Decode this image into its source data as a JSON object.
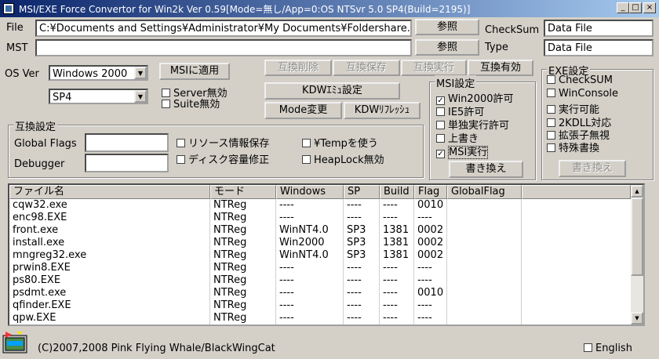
{
  "window": {
    "title": "MSI/EXE Force Convertor for Win2k Ver 0.59[Mode=無し/App=0:OS NTSvr 5.0 SP4(Build=2195)]",
    "controls": {
      "minimize": "_",
      "maximize": "□",
      "close": "×"
    }
  },
  "file_row": {
    "label": "File",
    "value": "C:¥Documents and Settings¥Administrator¥My Documents¥Foldershare.msi",
    "browse": "参照"
  },
  "mst_row": {
    "label": "MST",
    "value": "",
    "browse": "参照"
  },
  "checksum": {
    "label": "CheckSum",
    "value": "Data File"
  },
  "type": {
    "label": "Type",
    "value": "Data File"
  },
  "os": {
    "label": "OS Ver",
    "version": "Windows 2000",
    "sp": "SP4",
    "apply_msi": "MSIに適用",
    "server_disable": "Server無効",
    "suite_disable": "Suite無効"
  },
  "compat_buttons": {
    "delete": "互換削除",
    "save": "互換保存",
    "run": "互換実行",
    "enable": "互換有効"
  },
  "kdw": {
    "emu": "KDWｴﾐｭ設定",
    "mode_change": "Mode変更",
    "refresh": "KDWﾘﾌﾚｯｼｭ"
  },
  "compat_settings": {
    "title": "互換設定",
    "global_flags": "Global Flags",
    "global_flags_value": "",
    "debugger": "Debugger",
    "debugger_value": "",
    "resource_save": "リソース情報保存",
    "disk_fix": "ディスク容量修正",
    "use_temp": "¥Tempを使う",
    "heaplock": "HeapLock無効"
  },
  "msi_settings": {
    "title": "MSI設定",
    "items": [
      {
        "label": "Win2000許可",
        "checked": true
      },
      {
        "label": "IE5許可",
        "checked": false
      },
      {
        "label": "単独実行許可",
        "checked": false
      },
      {
        "label": "上書き",
        "checked": false
      },
      {
        "label": "MSI実行",
        "checked": true
      }
    ],
    "rewrite": "書き換え"
  },
  "exe_settings": {
    "title": "EXE設定",
    "items": [
      {
        "label": "CheckSUM",
        "checked": false
      },
      {
        "label": "WinConsole",
        "checked": false
      },
      {
        "label": "実行可能",
        "checked": false
      },
      {
        "label": "2KDLL対応",
        "checked": false
      },
      {
        "label": "拡張子無視",
        "checked": false
      },
      {
        "label": "特殊書換",
        "checked": false
      }
    ],
    "rewrite": "書き換え"
  },
  "table": {
    "columns": [
      "ファイル名",
      "モード",
      "Windows",
      "SP",
      "Build",
      "Flag",
      "GlobalFlag"
    ],
    "rows": [
      [
        "cqw32.exe",
        "NTReg",
        "----",
        "----",
        "----",
        "0010",
        ""
      ],
      [
        "enc98.EXE",
        "NTReg",
        "----",
        "----",
        "----",
        "----",
        ""
      ],
      [
        "front.exe",
        "NTReg",
        "WinNT4.0",
        "SP3",
        "1381",
        "0002",
        ""
      ],
      [
        "install.exe",
        "NTReg",
        "Win2000",
        "SP3",
        "1381",
        "0002",
        ""
      ],
      [
        "mngreg32.exe",
        "NTReg",
        "WinNT4.0",
        "SP3",
        "1381",
        "0002",
        ""
      ],
      [
        "prwin8.EXE",
        "NTReg",
        "----",
        "----",
        "----",
        "----",
        ""
      ],
      [
        "ps80.EXE",
        "NTReg",
        "----",
        "----",
        "----",
        "----",
        ""
      ],
      [
        "psdmt.exe",
        "NTReg",
        "----",
        "----",
        "----",
        "0010",
        ""
      ],
      [
        "qfinder.EXE",
        "NTReg",
        "----",
        "----",
        "----",
        "----",
        ""
      ],
      [
        "qpw.EXE",
        "NTReg",
        "----",
        "----",
        "----",
        "----",
        ""
      ]
    ]
  },
  "footer": {
    "copyright": "(C)2007,2008  Pink Flying Whale/BlackWingCat",
    "english": "English",
    "english_checked": false
  },
  "icons": {
    "app": "app-icon",
    "scroll_up": "scroll-up-icon",
    "scroll_down": "scroll-down-icon"
  }
}
